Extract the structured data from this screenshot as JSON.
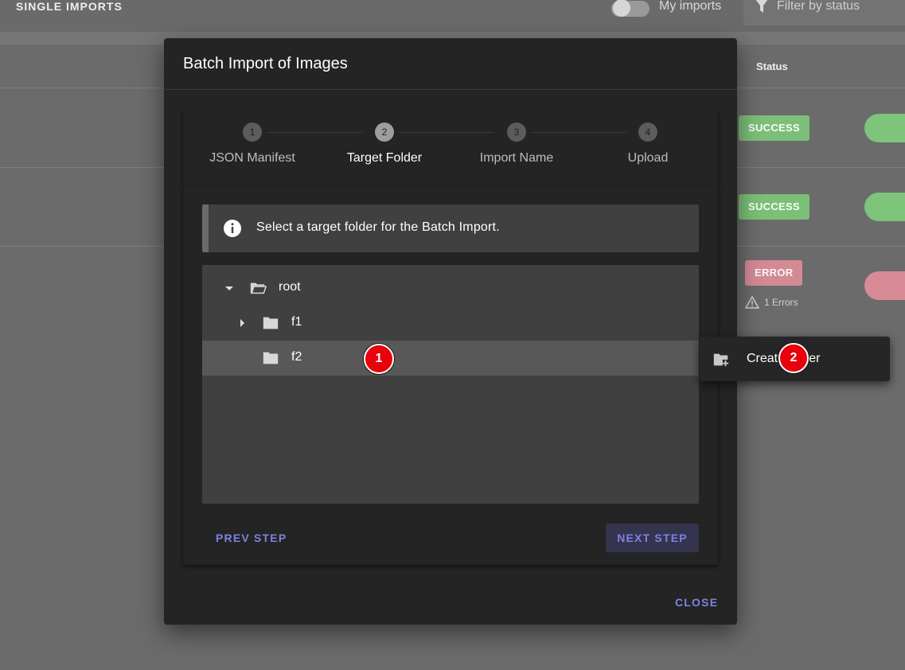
{
  "background": {
    "page_title": "SINGLE IMPORTS",
    "toggle_label": "My imports",
    "filter_placeholder": "Filter by status",
    "table_header_status": "Status",
    "rows": [
      {
        "status": "SUCCESS",
        "kind": "success"
      },
      {
        "status": "SUCCESS",
        "kind": "success"
      },
      {
        "status": "ERROR",
        "kind": "error",
        "errors": "1 Errors"
      }
    ]
  },
  "dialog": {
    "title": "Batch Import of Images",
    "steps": [
      {
        "number": "1",
        "label": "JSON Manifest"
      },
      {
        "number": "2",
        "label": "Target Folder"
      },
      {
        "number": "3",
        "label": "Import Name"
      },
      {
        "number": "4",
        "label": "Upload"
      }
    ],
    "active_step": 2,
    "alert_text": "Select a target folder for the Batch Import.",
    "tree": {
      "root": "root",
      "children": [
        "f1",
        "f2"
      ],
      "selected": "f2"
    },
    "prev_label": "PREV STEP",
    "next_label": "NEXT STEP",
    "close_label": "CLOSE"
  },
  "context_menu": {
    "item_label": "Create folder"
  },
  "markers": [
    "1",
    "2"
  ],
  "colors": {
    "accent": "#7e82e0",
    "success": "#7cbf78",
    "error": "#d38a95",
    "marker": "#e8000b"
  }
}
